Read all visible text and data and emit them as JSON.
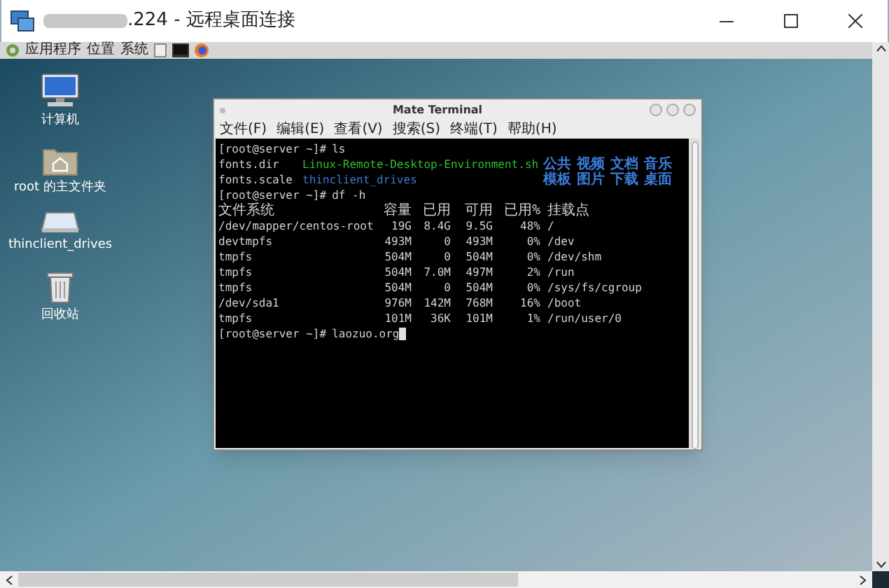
{
  "window": {
    "title": ".224 - 远程桌面连接"
  },
  "panel": {
    "menus": [
      "应用程序",
      "位置",
      "系统"
    ]
  },
  "desktop_icons": [
    {
      "kind": "computer",
      "label": "计算机"
    },
    {
      "kind": "home",
      "label": "root 的主文件夹"
    },
    {
      "kind": "drive",
      "label": "thinclient_drives"
    },
    {
      "kind": "trash",
      "label": "回收站"
    }
  ],
  "terminal": {
    "title": "Mate Terminal",
    "menus": [
      "文件(F)",
      "编辑(E)",
      "查看(V)",
      "搜索(S)",
      "终端(T)",
      "帮助(H)"
    ],
    "lines": [
      {
        "kind": "prompt",
        "prompt": "[root@server ~]#",
        "command": "ls",
        "cursor": false
      },
      {
        "kind": "ls",
        "items": [
          {
            "text": "fonts.dir",
            "color": "#d3d3d3"
          },
          {
            "text": "Linux-Remote-Desktop-Environment.sh",
            "color": "#2fbf2f"
          },
          {
            "text": "公共",
            "color": "#3b7bd8"
          },
          {
            "text": "视频",
            "color": "#3b7bd8"
          },
          {
            "text": "文档",
            "color": "#3b7bd8"
          },
          {
            "text": "音乐",
            "color": "#3b7bd8"
          }
        ]
      },
      {
        "kind": "ls",
        "items": [
          {
            "text": "fonts.scale",
            "color": "#d3d3d3"
          },
          {
            "text": "thinclient_drives",
            "color": "#3b7bd8"
          },
          {
            "text": "模板",
            "color": "#3b7bd8"
          },
          {
            "text": "图片",
            "color": "#3b7bd8"
          },
          {
            "text": "下载",
            "color": "#3b7bd8"
          },
          {
            "text": "桌面",
            "color": "#3b7bd8"
          }
        ]
      },
      {
        "kind": "prompt",
        "prompt": "[root@server ~]#",
        "command": "df -h",
        "cursor": false
      },
      {
        "kind": "df_header",
        "cells": [
          "文件系统",
          "容量",
          "已用",
          "可用",
          "已用%",
          "挂载点"
        ]
      },
      {
        "kind": "df_row",
        "cells": [
          "/dev/mapper/centos-root",
          "19G",
          "8.4G",
          "9.5G",
          "48%",
          "/"
        ]
      },
      {
        "kind": "df_row",
        "cells": [
          "devtmpfs",
          "493M",
          "0",
          "493M",
          "0%",
          "/dev"
        ]
      },
      {
        "kind": "df_row",
        "cells": [
          "tmpfs",
          "504M",
          "0",
          "504M",
          "0%",
          "/dev/shm"
        ]
      },
      {
        "kind": "df_row",
        "cells": [
          "tmpfs",
          "504M",
          "7.0M",
          "497M",
          "2%",
          "/run"
        ]
      },
      {
        "kind": "df_row",
        "cells": [
          "tmpfs",
          "504M",
          "0",
          "504M",
          "0%",
          "/sys/fs/cgroup"
        ]
      },
      {
        "kind": "df_row",
        "cells": [
          "/dev/sda1",
          "976M",
          "142M",
          "768M",
          "16%",
          "/boot"
        ]
      },
      {
        "kind": "df_row",
        "cells": [
          "tmpfs",
          "101M",
          "36K",
          "101M",
          "1%",
          "/run/user/0"
        ]
      },
      {
        "kind": "prompt",
        "prompt": "[root@server ~]#",
        "command": "laozuo.org",
        "cursor": true
      }
    ]
  }
}
